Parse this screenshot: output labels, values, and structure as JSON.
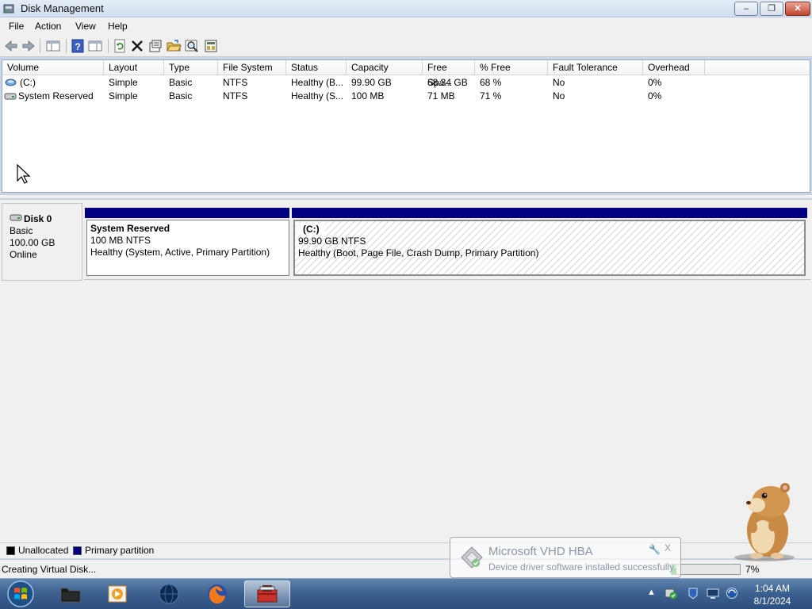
{
  "window": {
    "title": "Disk Management",
    "icon": "disk-management-icon",
    "minimize_label": "‒",
    "maximize_label": "❐",
    "close_label": "✕"
  },
  "menu": [
    "File",
    "Action",
    "View",
    "Help"
  ],
  "toolbar": {
    "icons": [
      "back-arrow-icon",
      "forward-arrow-icon",
      "show-hide-console-tree-icon",
      "help-icon",
      "properties-pane-icon",
      "refresh-icon",
      "delete-icon",
      "properties-icon",
      "open-folder-icon",
      "search-icon",
      "rescan-disks-icon"
    ]
  },
  "volume_list": {
    "columns": [
      "Volume",
      "Layout",
      "Type",
      "File System",
      "Status",
      "Capacity",
      "Free Spa...",
      "% Free",
      "Fault Tolerance",
      "Overhead"
    ],
    "rows": [
      {
        "icon": "volume-icon",
        "cells": [
          "(C:)",
          "Simple",
          "Basic",
          "NTFS",
          "Healthy (B...",
          "99.90 GB",
          "68.34 GB",
          "68 %",
          "No",
          "0%"
        ]
      },
      {
        "icon": "drive-icon",
        "cells": [
          "System Reserved",
          "Simple",
          "Basic",
          "NTFS",
          "Healthy (S...",
          "100 MB",
          "71 MB",
          "71 %",
          "No",
          "0%"
        ]
      }
    ]
  },
  "disk": {
    "name": "Disk 0",
    "type": "Basic",
    "size": "100.00 GB",
    "state": "Online",
    "partitions": [
      {
        "name": "System Reserved",
        "size_fs": "100 MB NTFS",
        "status": "Healthy (System, Active, Primary Partition)",
        "selected": false
      },
      {
        "name": "(C:)",
        "size_fs": "99.90 GB NTFS",
        "status": "Healthy (Boot, Page File, Crash Dump, Primary Partition)",
        "selected": true
      }
    ]
  },
  "legend": [
    {
      "label": "Unallocated",
      "color": "#000000"
    },
    {
      "label": "Primary partition",
      "color": "#000080"
    }
  ],
  "status": {
    "text": "Creating Virtual Disk...",
    "progress_percent": 7,
    "progress_label": "7%"
  },
  "notification": {
    "title": "Microsoft VHD HBA",
    "body": "Device driver software installed successfully.",
    "tool_icon": "wrench-icon",
    "close_label": "X"
  },
  "taskbar": {
    "apps": [
      "explorer",
      "media-player",
      "network-globe",
      "firefox",
      "disk-management"
    ],
    "active_app": "disk-management",
    "tray_icons": [
      "show-hidden-icons-arrow",
      "device-install-icon",
      "action-center-icon",
      "network-icon",
      "volume-icon"
    ],
    "time": "1:04 AM",
    "date": "8/1/2024"
  }
}
